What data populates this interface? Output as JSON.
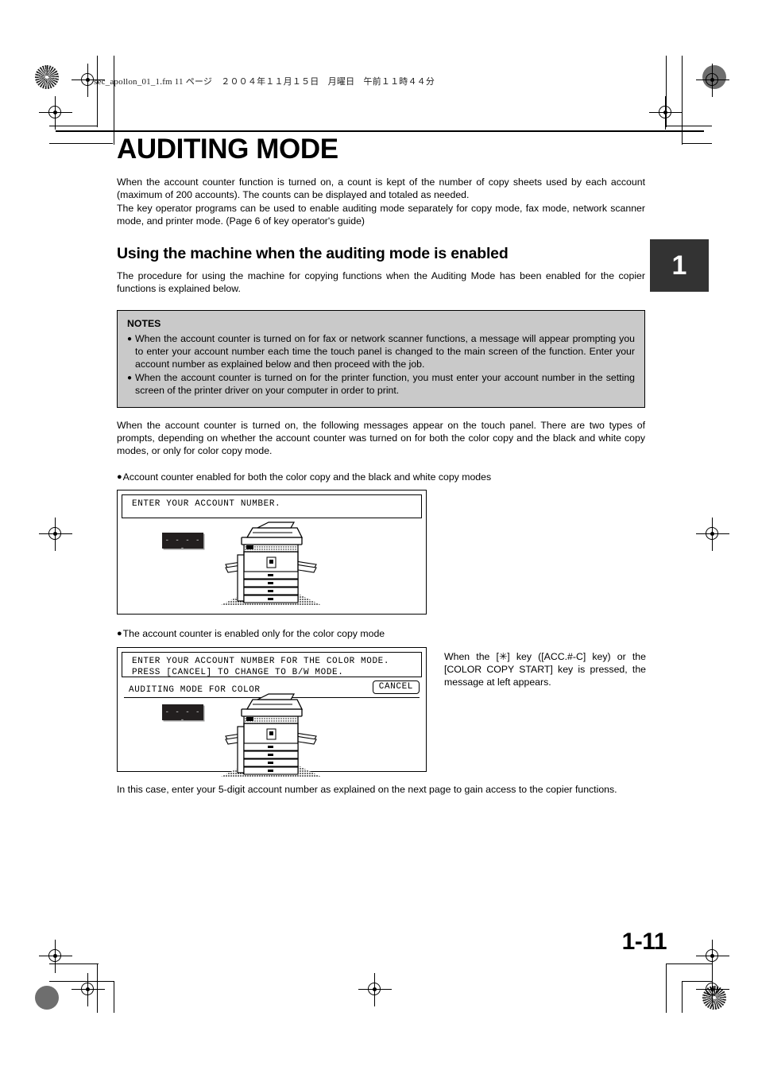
{
  "header": {
    "slug": "sec_apollon_01_1.fm  11 ページ　２００４年１１月１５日　月曜日　午前１１時４４分"
  },
  "chapter_tab": {
    "number": "1"
  },
  "doc": {
    "title": "AUDITING MODE",
    "intro_paragraph_1": "When the account counter function is turned on, a count is kept of the number of copy sheets used by each account (maximum of 200 accounts). The counts can be displayed and totaled as needed.",
    "intro_paragraph_2": "The key operator programs can be used to enable auditing mode separately for copy mode, fax mode, network scanner mode, and printer mode. (Page 6 of key operator's guide)",
    "section_title": "Using the machine when the auditing mode is enabled",
    "section_paragraph": "The procedure for using the machine for copying functions when the Auditing Mode has been enabled for the copier functions is explained below.",
    "after_notes_paragraph": "When the account counter is turned on, the following messages appear on the touch panel. There are two types of prompts, depending on whether the account counter was turned on for both the color copy and the black and white copy modes, or only for color copy mode.",
    "closing_paragraph": "In this case, enter your 5-digit account number as explained on the next page to gain access to the copier functions."
  },
  "notes": {
    "title": "NOTES",
    "bullet": "●",
    "items": [
      "When the account counter is turned on for fax or network scanner functions, a message will appear prompting you to enter your account number each time the touch panel is changed to the main screen of the function. Enter your account number as explained below and then proceed with the job.",
      "When the account counter is turned on for the printer function, you must enter your account number in the setting screen of the printer driver on your computer in order to print."
    ]
  },
  "figure_one": {
    "caption_bullet": "●",
    "caption": "Account counter enabled for both the color copy and the black and white copy modes",
    "panel": {
      "message_line_1": "ENTER YOUR ACCOUNT NUMBER.",
      "account_field_dashes": "- - - - -"
    }
  },
  "figure_two": {
    "caption_bullet": "●",
    "caption": "The account counter is enabled only for the color copy mode",
    "panel": {
      "message_line_1": "ENTER YOUR ACCOUNT NUMBER FOR THE COLOR MODE.",
      "message_line_2": "PRESS [CANCEL] TO CHANGE TO B/W MODE.",
      "sub_label": "AUDITING MODE FOR COLOR",
      "cancel_label": "CANCEL",
      "account_field_dashes": "- - - - -"
    },
    "side_note": "When the [✳] key ([ACC.#-C] key) or the [COLOR COPY START] key is pressed, the message at left appears."
  },
  "footer": {
    "page_number": "1-11"
  },
  "colors": {
    "notes_background": "#c9c9c9",
    "chapter_tab_background": "#333333",
    "account_field_background": "#231f1f",
    "text": "#000000"
  }
}
